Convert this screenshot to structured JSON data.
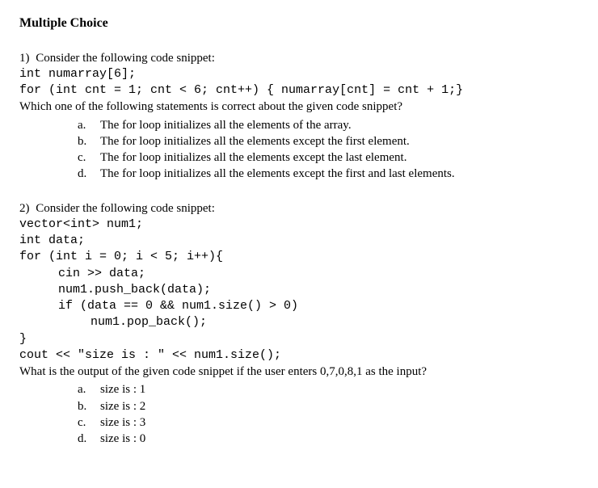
{
  "heading": "Multiple Choice",
  "q1": {
    "num": "1)",
    "stem": "Consider the following code snippet:",
    "code1": "int numarray[6];",
    "code2": "for (int cnt = 1; cnt < 6; cnt++) { numarray[cnt] = cnt + 1;}",
    "prompt": "Which one of the following statements is correct about the given code snippet?",
    "a": {
      "l": "a.",
      "t": "The for loop initializes all the elements of the array."
    },
    "b": {
      "l": "b.",
      "t": "The for loop initializes all the elements except the first element."
    },
    "c": {
      "l": "c.",
      "t": "The for loop initializes all the elements except the last element."
    },
    "d": {
      "l": "d.",
      "t": "The for loop initializes all the elements except the first and last elements."
    }
  },
  "q2": {
    "num": "2)",
    "stem": "Consider the following code snippet:",
    "c1": "vector<int> num1;",
    "c2": "int data;",
    "c3": "for (int i = 0; i < 5; i++){",
    "c4": "cin >> data;",
    "c5": "num1.push_back(data);",
    "c6": "if (data == 0 && num1.size() > 0)",
    "c7": "num1.pop_back();",
    "c8": "}",
    "c9": "cout << \"size is : \" << num1.size();",
    "prompt": "What is the output of the given code snippet if the user enters 0,7,0,8,1 as the input?",
    "a": {
      "l": "a.",
      "t": "size is : 1"
    },
    "b": {
      "l": "b.",
      "t": "size is : 2"
    },
    "c": {
      "l": "c.",
      "t": "size is : 3"
    },
    "d": {
      "l": "d.",
      "t": "size is : 0"
    }
  }
}
